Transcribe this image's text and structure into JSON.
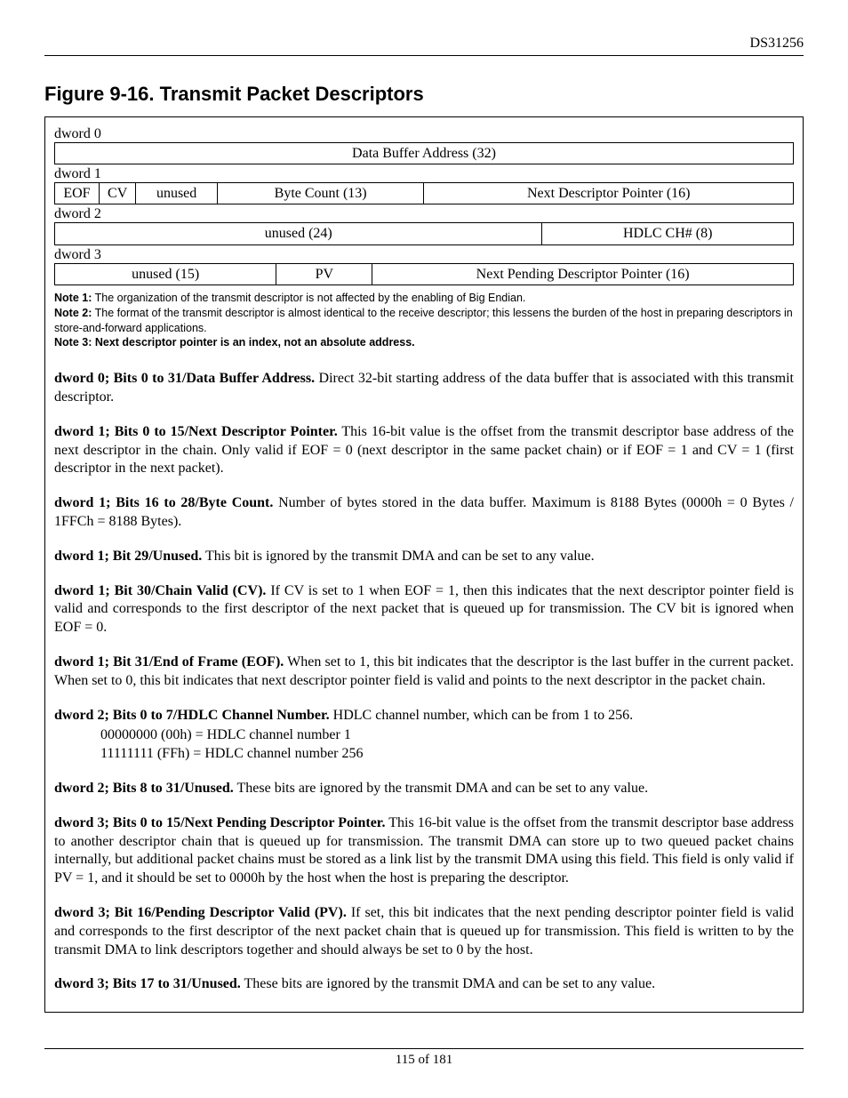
{
  "header": {
    "doc_id": "DS31256"
  },
  "figure_title": "Figure 9-16. Transmit Packet Descriptors",
  "rows": {
    "d0_label": "dword 0",
    "d0_cell": "Data Buffer Address (32)",
    "d1_label": "dword 1",
    "d1_eof": "EOF",
    "d1_cv": "CV",
    "d1_unused": "unused",
    "d1_bytecount": "Byte Count (13)",
    "d1_nextptr": "Next Descriptor Pointer (16)",
    "d2_label": "dword 2",
    "d2_unused": "unused (24)",
    "d2_hdlc": "HDLC CH# (8)",
    "d3_label": "dword 3",
    "d3_unused": "unused (15)",
    "d3_pv": "PV",
    "d3_nextpend": "Next Pending Descriptor Pointer (16)"
  },
  "notes": {
    "n1_label": "Note 1:",
    "n1_text": " The organization of the transmit descriptor is not affected by the enabling of Big Endian.",
    "n2_label": "Note 2:",
    "n2_text": " The format of the transmit descriptor is almost identical to the receive descriptor; this lessens the burden of the host in preparing descriptors in store-and-forward applications.",
    "n3_label": "Note 3: Next descriptor pointer is an index, not an absolute address."
  },
  "paras": {
    "p1_b": "dword 0; Bits 0 to 31/Data Buffer Address.",
    "p1_t": " Direct 32-bit starting address of the data buffer that is associated with this transmit descriptor.",
    "p2_b": "dword 1; Bits 0 to 15/Next Descriptor Pointer.",
    "p2_t": " This 16-bit value is the offset from the transmit descriptor base address of the next descriptor in the chain. Only valid if EOF = 0 (next descriptor in the same packet chain) or if EOF = 1 and CV = 1 (first descriptor in the next packet).",
    "p3_b": "dword 1; Bits 16 to 28/Byte Count.",
    "p3_t": " Number of bytes stored in the data buffer. Maximum is 8188 Bytes (0000h = 0 Bytes / 1FFCh = 8188 Bytes).",
    "p4_b": "dword 1; Bit 29/Unused.",
    "p4_t": " This bit is ignored by the transmit DMA and can be set to any value.",
    "p5_b": "dword 1; Bit 30/Chain Valid (CV).",
    "p5_t": " If CV is set to 1 when EOF = 1, then this indicates that the next descriptor pointer field is valid and corresponds to the first descriptor of the next packet that is queued up for transmission. The CV bit is ignored when EOF = 0.",
    "p6_b": "dword 1; Bit 31/End of Frame (EOF).",
    "p6_t": " When set to 1, this bit indicates that the descriptor is the last buffer in the current packet. When set to 0, this bit indicates that next descriptor pointer field is valid and points to the next descriptor in the packet chain.",
    "p7_b": "dword 2; Bits 0 to 7/HDLC Channel Number.",
    "p7_t": " HDLC channel number, which can be from 1 to 256.",
    "p7_l1": "00000000 (00h) = HDLC channel number 1",
    "p7_l2": "11111111 (FFh) = HDLC channel number 256",
    "p8_b": "dword 2; Bits 8 to 31/Unused.",
    "p8_t": " These bits are ignored by the transmit DMA and can be set to any value.",
    "p9_b": "dword 3; Bits 0 to 15/Next Pending Descriptor Pointer.",
    "p9_t": " This 16-bit value is the offset from the transmit descriptor base address to another descriptor chain that is queued up for transmission. The transmit DMA can store up to two queued packet chains internally, but additional packet chains must be stored as a link list by the transmit DMA using this field. This field is only valid if PV = 1, and it should be set to 0000h by the host when the host is preparing the descriptor.",
    "p10_b": "dword 3; Bit 16/Pending Descriptor Valid (PV).",
    "p10_t": " If set, this bit indicates that the next pending descriptor pointer field is valid and corresponds to the first descriptor of the next packet chain that is queued up for transmission. This field is written to by the transmit DMA to link descriptors together and should always be set to 0 by the host.",
    "p11_b": "dword 3; Bits 17 to 31/Unused.",
    "p11_t": " These bits are ignored by the transmit DMA and can be set to any value."
  },
  "footer": {
    "page": "115 of 181"
  }
}
